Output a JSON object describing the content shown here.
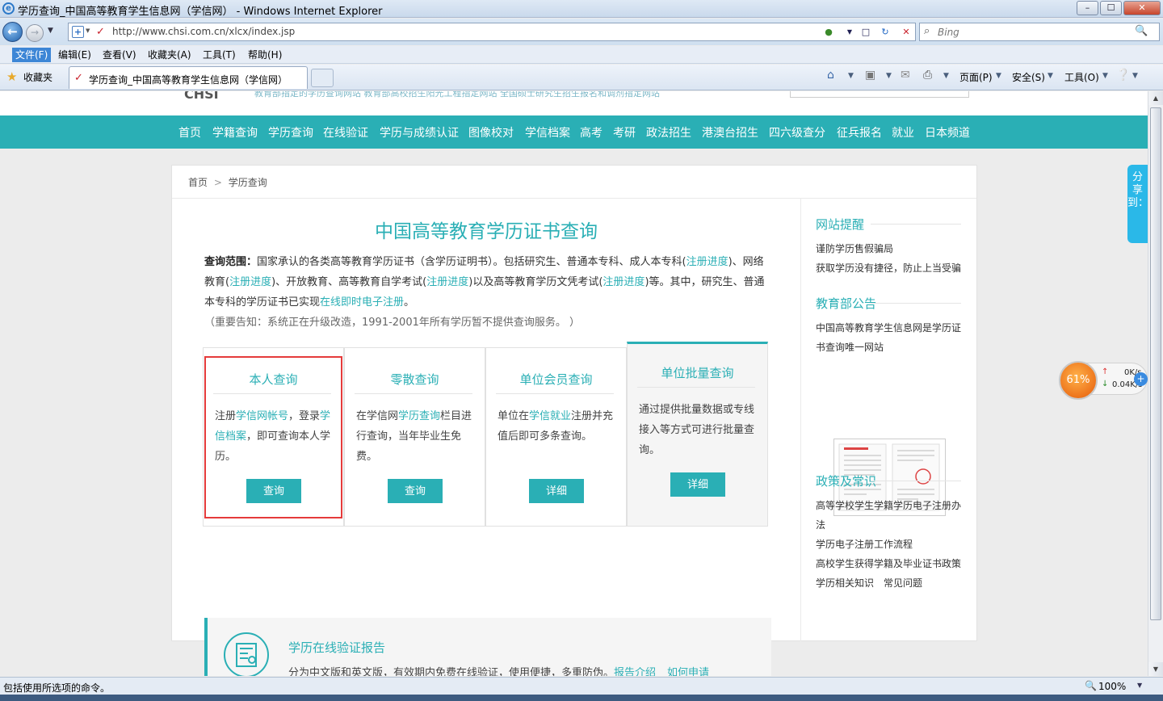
{
  "window": {
    "title": "学历查询_中国高等教育学生信息网（学信网） - Windows Internet Explorer",
    "minimize": "–",
    "maximize": "☐",
    "close": "✕"
  },
  "address": {
    "url": "http://www.chsi.com.cn/xlcx/index.jsp",
    "search_placeholder": "Bing"
  },
  "menu": [
    "文件(F)",
    "编辑(E)",
    "查看(V)",
    "收藏夹(A)",
    "工具(T)",
    "帮助(H)"
  ],
  "favorites": {
    "label": "收藏夹",
    "tab_title": "学历查询_中国高等教育学生信息网（学信网）"
  },
  "commandbar": {
    "page": "页面(P)",
    "safety": "安全(S)",
    "tools": "工具(O)"
  },
  "site": {
    "logo": "CHSI",
    "top_strip": "教育部指定的学历查询网站  教育部高校招生阳光工程指定网站  全国硕士研究生招生报名和调剂指定网站",
    "nav": [
      "首页",
      "学籍查询",
      "学历查询",
      "在线验证",
      "学历与成绩认证",
      "图像校对",
      "学信档案",
      "高考",
      "考研",
      "政法招生",
      "港澳台招生",
      "四六级查分",
      "征兵报名",
      "就业",
      "日本频道"
    ]
  },
  "breadcrumb": {
    "home": "首页",
    "sep": ">",
    "current": "学历查询"
  },
  "main": {
    "title": "中国高等教育学历证书查询",
    "scope_label": "查询范围：",
    "scope_text1": "国家承认的各类高等教育学历证书（含学历证明书）。包括研究生、普通本专科、成人本专科(",
    "scope_link1": "注册进度",
    "scope_text2": ")、网络教育(",
    "scope_link2": "注册进度",
    "scope_text3": ")、开放教育、高等教育自学考试(",
    "scope_link3": "注册进度",
    "scope_text4": ")以及高等教育学历文凭考试(",
    "scope_link4": "注册进度",
    "scope_text5": ")等。其中，研究生、普通本专科的学历证书已实现",
    "scope_link5": "在线即时电子注册",
    "scope_text6": "。",
    "notice": "（重要告知：系统正在升级改造，1991-2001年所有学历暂不提供查询服务。 ）"
  },
  "cards": [
    {
      "title": "本人查询",
      "t1": "注册",
      "l1": "学信网帐号",
      "t2": "，登录",
      "l2": "学信档案",
      "t3": "，即可查询本人学历。",
      "button": "查询"
    },
    {
      "title": "零散查询",
      "t1": "在学信网",
      "l1": "学历查询",
      "t2": "栏目进行查询，当年毕业生免费。",
      "button": "查询"
    },
    {
      "title": "单位会员查询",
      "t1": "单位在",
      "l1": "学信就业",
      "t2": "注册并充值后即可多条查询。",
      "button": "详细"
    },
    {
      "title": "单位批量查询",
      "t1": "通过提供批量数据或专线接入等方式可进行批量查询。",
      "button": "详细"
    }
  ],
  "report": {
    "title": "学历在线验证报告",
    "desc": "分为中文版和英文版，有效期内免费在线验证，使用便捷，多重防伪。",
    "link1": "报告介绍",
    "link2": "如何申请"
  },
  "sidebar": {
    "reminder_title": "网站提醒",
    "reminders": [
      "谨防学历售假骗局",
      "获取学历没有捷径，防止上当受骗"
    ],
    "moe_title": "教育部公告",
    "moe_text": "中国高等教育学生信息网是学历证书查询唯一网站",
    "policy_title": "政策及常识",
    "policies": [
      "高等学校学生学籍学历电子注册办法",
      "学历电子注册工作流程",
      "高校学生获得学籍及毕业证书政策"
    ],
    "bottom1": "学历相关知识",
    "bottom2": "常见问题"
  },
  "share": {
    "label": "分享到："
  },
  "netspeed": {
    "percent": "61%",
    "up": "0K/s",
    "down": "0.04K/s"
  },
  "status": {
    "text": "包括使用所选项的命令。",
    "zoom": "100%"
  },
  "colors": {
    "accent": "#2aafb5",
    "highlight_border": "#e53b3b"
  }
}
